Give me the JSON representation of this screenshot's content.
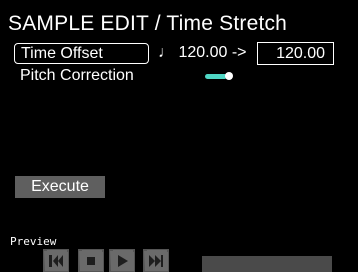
{
  "header": {
    "title": "SAMPLE EDIT / Time Stretch"
  },
  "time_offset": {
    "label": "Time Offset",
    "tempo_display": "♩ 120.00 ->",
    "target_value": "120.00"
  },
  "pitch_correction": {
    "label": "Pitch Correction",
    "enabled": true
  },
  "execute_label": "Execute",
  "preview": {
    "label": "Preview",
    "controls": [
      "skip-to-start-icon",
      "stop-icon",
      "play-icon",
      "fast-forward-icon"
    ]
  },
  "colors": {
    "accent": "#4fd6c4",
    "button_bg": "#5f5f5f",
    "control_bg": "#555555"
  }
}
